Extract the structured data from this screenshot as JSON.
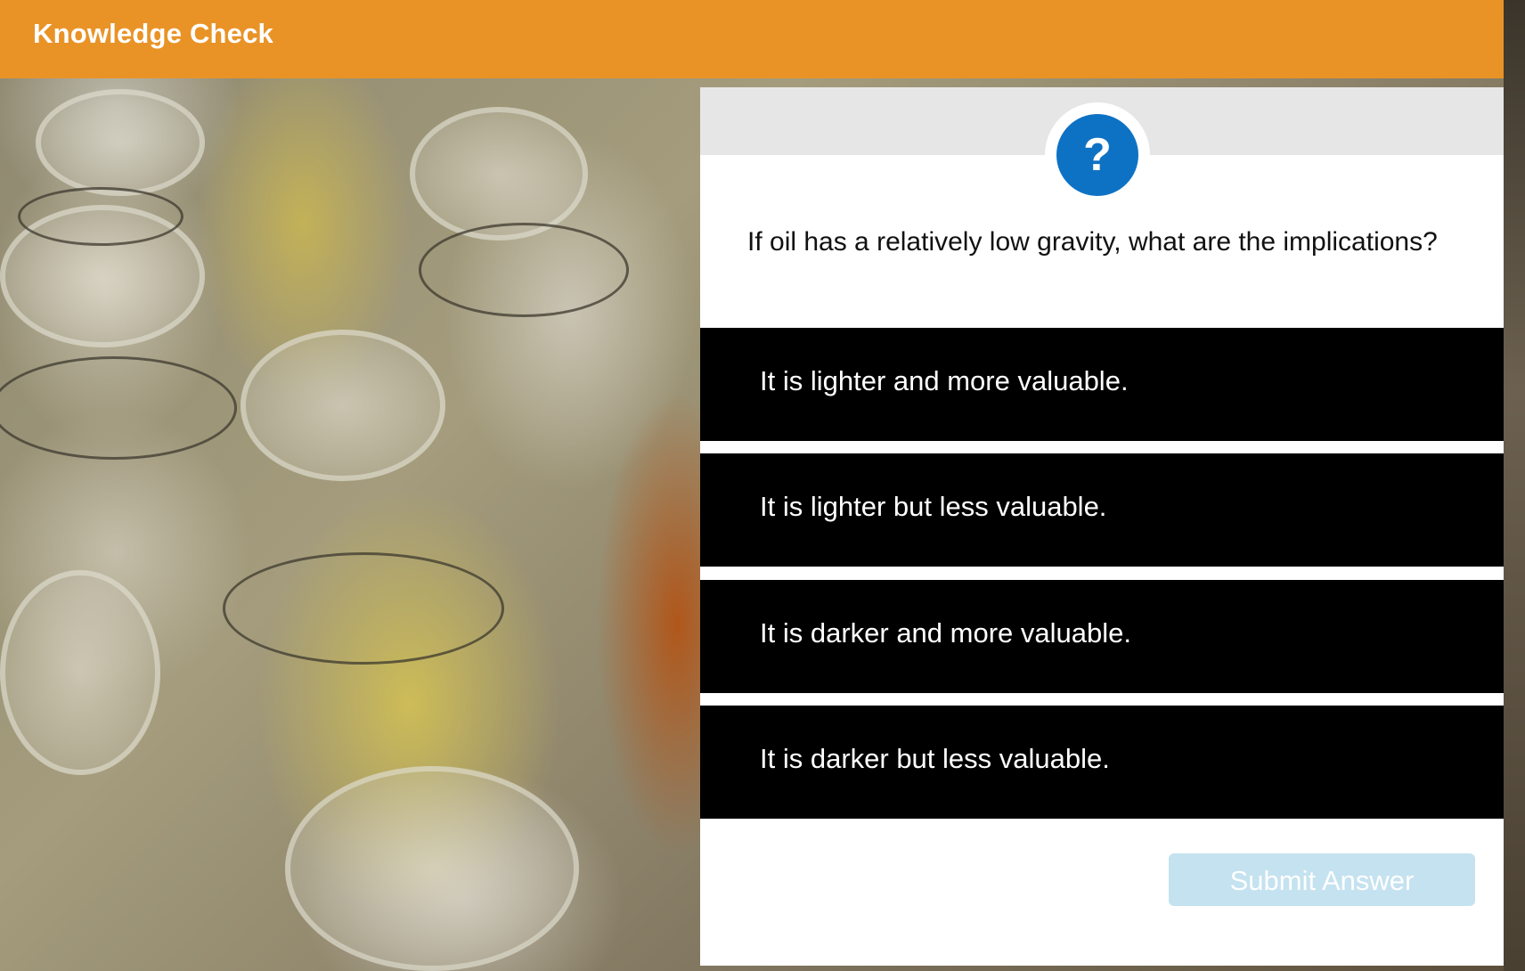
{
  "header": {
    "title": "Knowledge Check"
  },
  "background": {
    "description_icon": "photo-bottles"
  },
  "question": {
    "icon": "question-mark-icon",
    "icon_glyph": "?",
    "text": "If oil has a relatively low gravity, what are the implications?"
  },
  "options": [
    {
      "label": "It is lighter and more valuable."
    },
    {
      "label": "It is lighter but less valuable."
    },
    {
      "label": "It is darker and more valuable."
    },
    {
      "label": "It is darker but less valuable."
    }
  ],
  "submit": {
    "label": "Submit Answer",
    "enabled": false
  },
  "colors": {
    "header": "#e99327",
    "accent": "#0e72c4",
    "option_bg": "#000000",
    "submit_disabled": "#c4e2ef"
  }
}
